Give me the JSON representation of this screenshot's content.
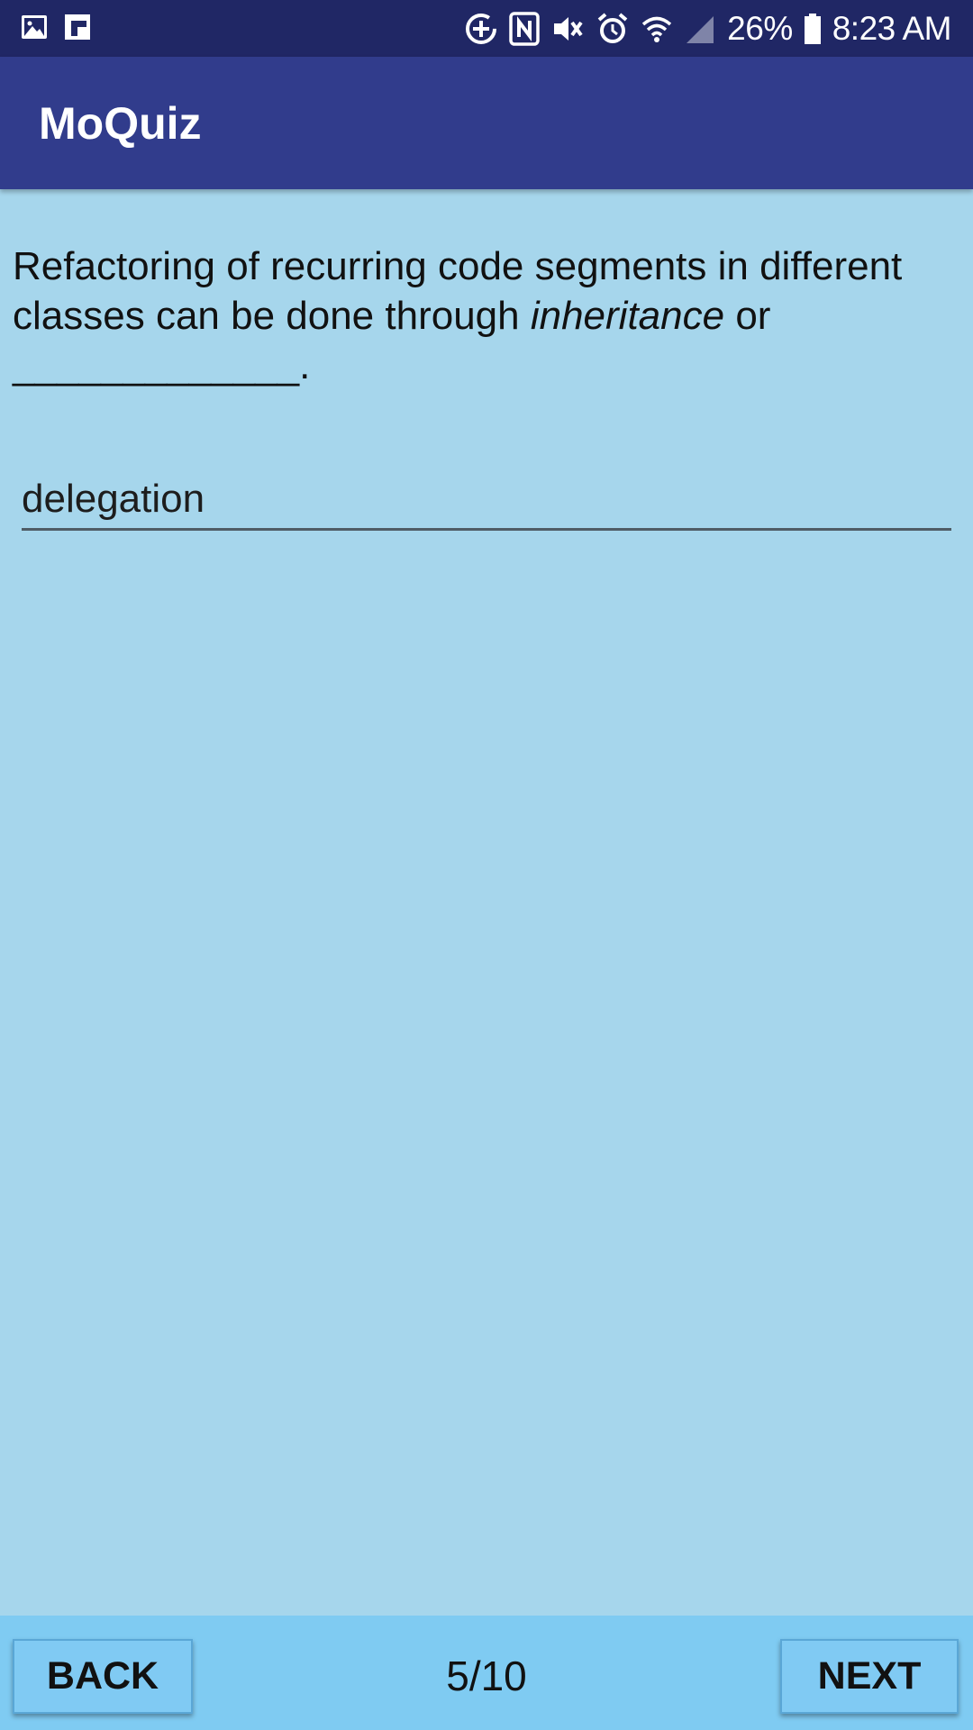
{
  "status_bar": {
    "icons": [
      "gallery-icon",
      "flipboard-icon",
      "data-saver-icon",
      "nfc-icon",
      "vibrate-icon",
      "alarm-icon",
      "wifi-icon",
      "cell-signal-icon",
      "battery-icon"
    ],
    "battery_percent": "26%",
    "time": "8:23 AM"
  },
  "app_bar": {
    "title": "MoQuiz",
    "color": "#313c8c"
  },
  "question": {
    "text_before": "Refactoring of recurring code segments in different classes can be done through ",
    "emphasis": "inheritance",
    "text_after": " or _____________."
  },
  "answer": {
    "value": "delegation"
  },
  "navigation": {
    "back_label": "BACK",
    "next_label": "NEXT",
    "progress": "5/10"
  },
  "colors": {
    "status_bar": "#202765",
    "background": "#a6d6ec",
    "bottom_bar": "#7fcbf2"
  }
}
